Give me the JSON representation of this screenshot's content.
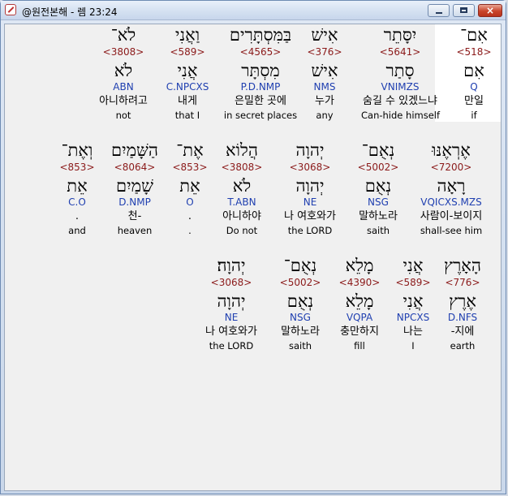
{
  "window": {
    "title": "@원전본해 - 렘 23:24",
    "icon": "app-icon",
    "buttons": {
      "minimize": "minimize-icon",
      "maximize": "maximize-icon",
      "close": "×"
    }
  },
  "rows": [
    [
      {
        "heb": "אִם־",
        "strong": "<518>",
        "lemma": "אִם",
        "morph": "Q",
        "kor": "만일",
        "eng": "if",
        "highlight": true
      },
      {
        "heb": "יִסָּתֵר",
        "strong": "<5641>",
        "lemma": "סָתַר",
        "morph": "VNIMZS",
        "kor": "숨길 수 있겠느냐",
        "eng": "Can-hide himself"
      },
      {
        "heb": "אִישׁ",
        "strong": "<376>",
        "lemma": "אִישׁ",
        "morph": "NMS",
        "kor": "누가",
        "eng": "any"
      },
      {
        "heb": "בַּמִּסְתָּרִים",
        "strong": "<4565>",
        "lemma": "מִסְתָּר",
        "morph": "P.D.NMP",
        "kor": "은밀한 곳에",
        "eng": "in secret places"
      },
      {
        "heb": "וַאֲנִי",
        "strong": "<589>",
        "lemma": "אֲנִי",
        "morph": "C.NPCXS",
        "kor": "내게",
        "eng": "that I"
      },
      {
        "heb": "לֹא־",
        "strong": "<3808>",
        "lemma": "לֹא",
        "morph": "ABN",
        "kor": "아니하려고",
        "eng": "not"
      }
    ],
    [
      {
        "heb": "אֶרְאֶנּוּ",
        "strong": "<7200>",
        "lemma": "רָאָה",
        "morph": "VQICXS.MZS",
        "kor": "사람이-보이지",
        "eng": "shall-see him"
      },
      {
        "heb": "נְאֻם־",
        "strong": "<5002>",
        "lemma": "נְאֻם",
        "morph": "NSG",
        "kor": "말하노라",
        "eng": "saith"
      },
      {
        "heb": "יְהוָה",
        "strong": "<3068>",
        "lemma": "יְהוָה",
        "morph": "NE",
        "kor": "나 여호와가",
        "eng": "the LORD"
      },
      {
        "heb": "הֲלוֹא",
        "strong": "<3808>",
        "lemma": "לֹא",
        "morph": "T.ABN",
        "kor": "아니하야",
        "eng": "Do not"
      },
      {
        "heb": "אֶת־",
        "strong": "<853>",
        "lemma": "אֵת",
        "morph": "O",
        "kor": ".",
        "eng": "."
      },
      {
        "heb": "הַשָּׁמַיִם",
        "strong": "<8064>",
        "lemma": "שָׁמַיִם",
        "morph": "D.NMP",
        "kor": "천-",
        "eng": "heaven"
      },
      {
        "heb": "וְאֶת־",
        "strong": "<853>",
        "lemma": "אֵת",
        "morph": "C.O",
        "kor": ".",
        "eng": "and"
      }
    ],
    [
      {
        "heb": "הָאָרֶץ",
        "strong": "<776>",
        "lemma": "אֶרֶץ",
        "morph": "D.NFS",
        "kor": "-지에",
        "eng": "earth"
      },
      {
        "heb": "אֲנִי",
        "strong": "<589>",
        "lemma": "אֲנִי",
        "morph": "NPCXS",
        "kor": "나는",
        "eng": "I"
      },
      {
        "heb": "מָלֵא",
        "strong": "<4390>",
        "lemma": "מָלֵא",
        "morph": "VQPA",
        "kor": "충만하지",
        "eng": "fill"
      },
      {
        "heb": "נְאֻם־",
        "strong": "<5002>",
        "lemma": "נְאֻם",
        "morph": "NSG",
        "kor": "말하노라",
        "eng": "saith"
      },
      {
        "heb": "יְהוָה׃",
        "strong": "<3068>",
        "lemma": "יְהוָה",
        "morph": "NE",
        "kor": "나 여호와가",
        "eng": "the LORD"
      }
    ]
  ]
}
